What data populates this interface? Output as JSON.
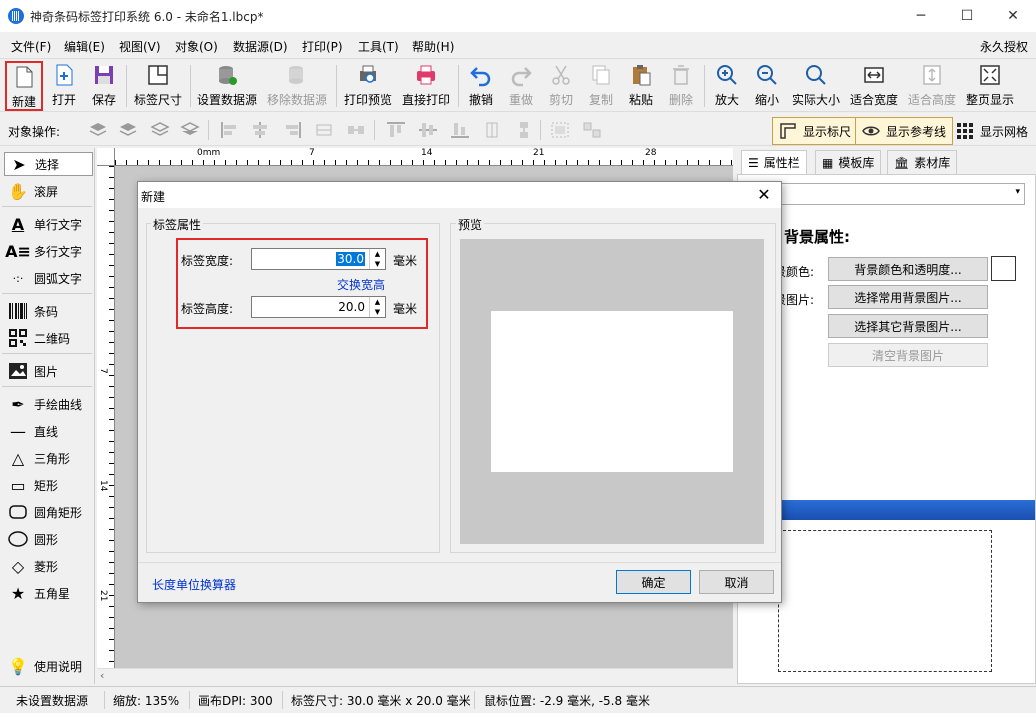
{
  "window": {
    "title": "神奇条码标签打印系统 6.0 - 未命名1.lbcp*",
    "minimize": "─",
    "maximize": "☐",
    "close": "✕"
  },
  "menu": {
    "items": [
      "文件(F)",
      "编辑(E)",
      "视图(V)",
      "对象(O)",
      "数据源(D)",
      "打印(P)",
      "工具(T)",
      "帮助(H)"
    ],
    "license": "永久授权"
  },
  "toolbar": {
    "new": "新建",
    "open": "打开",
    "save": "保存",
    "label_size": "标签尺寸",
    "set_datasource": "设置数据源",
    "remove_datasource": "移除数据源",
    "print_preview": "打印预览",
    "direct_print": "直接打印",
    "undo": "撤销",
    "redo": "重做",
    "cut": "剪切",
    "copy": "复制",
    "paste": "粘贴",
    "delete": "删除",
    "zoom_in": "放大",
    "zoom_out": "缩小",
    "actual_size": "实际大小",
    "fit_width": "适合宽度",
    "fit_height": "适合高度",
    "full_page": "整页显示"
  },
  "ops": {
    "label": "对象操作:",
    "show_ruler": "显示标尺",
    "show_guides": "显示参考线",
    "show_grid": "显示网格"
  },
  "tools": {
    "select": "选择",
    "scroll": "滚屏",
    "single_text": "单行文字",
    "multi_text": "多行文字",
    "arc_text": "圆弧文字",
    "barcode": "条码",
    "qrcode": "二维码",
    "image": "图片",
    "freehand": "手绘曲线",
    "line": "直线",
    "triangle": "三角形",
    "rect": "矩形",
    "round_rect": "圆角矩形",
    "ellipse": "圆形",
    "diamond": "菱形",
    "star": "五角星",
    "help": "使用说明"
  },
  "ruler": {
    "top_marks": [
      "0mm",
      "7",
      "14",
      "21",
      "28"
    ],
    "left_marks": [
      "7",
      "14",
      "21"
    ]
  },
  "right_panel": {
    "tabs": [
      "属性栏",
      "模板库",
      "素材库"
    ],
    "heading": "背景属性:",
    "bg_color_label": "景颜色:",
    "bg_image_label": "景图片:",
    "btn_bg_color": "背景颜色和透明度...",
    "btn_common_bg": "选择常用背景图片...",
    "btn_other_bg": "选择其它背景图片...",
    "btn_clear_bg": "清空背景图片"
  },
  "dialog": {
    "title": "新建",
    "group_label": "标签属性",
    "preview_label": "预览",
    "width_label": "标签宽度:",
    "width_value": "30.0",
    "height_label": "标签高度:",
    "height_value": "20.0",
    "unit": "毫米",
    "swap": "交换宽高",
    "converter": "长度单位换算器",
    "ok": "确定",
    "cancel": "取消"
  },
  "status": {
    "datasource": "未设置数据源",
    "zoom": "缩放: 135%",
    "dpi": "画布DPI: 300",
    "label_size": "标签尺寸: 30.0 毫米 x 20.0 毫米",
    "mouse": "鼠标位置: -2.9 毫米, -5.8 毫米"
  }
}
